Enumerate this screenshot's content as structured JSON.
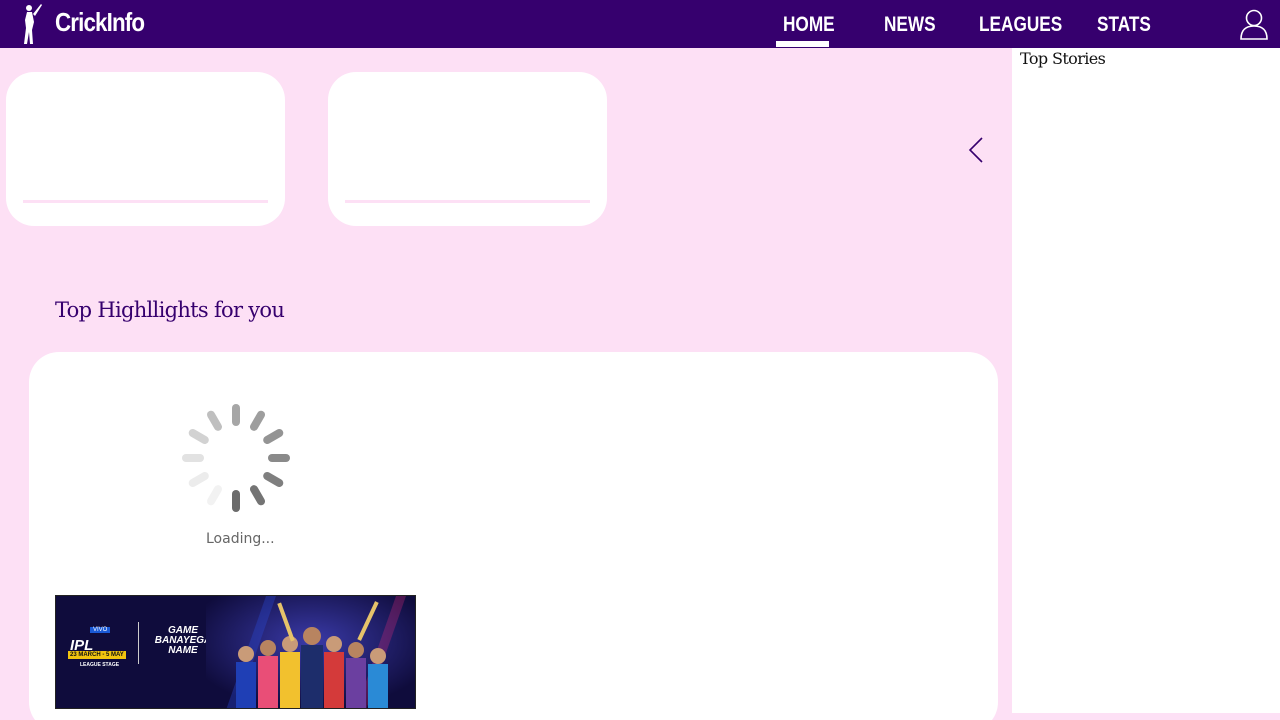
{
  "header": {
    "brand": "CrickInfo",
    "nav": [
      {
        "label": "HOME",
        "active": true
      },
      {
        "label": "NEWS",
        "active": false
      },
      {
        "label": "LEAGUES",
        "active": false
      },
      {
        "label": "STATS",
        "active": false
      }
    ],
    "user_icon": "user-icon",
    "logo_icon": "cricketer-logo-icon"
  },
  "colors": {
    "header_bg": "#36006e",
    "page_bg": "#fde0f5",
    "card_bg": "#ffffff",
    "heading": "#36006e"
  },
  "match_cards": [
    {
      "id": "card-1"
    },
    {
      "id": "card-2"
    }
  ],
  "carousel": {
    "prev_icon": "chevron-left-icon"
  },
  "highlights": {
    "title": "Top Highllights for you",
    "loading_text": "Loading..."
  },
  "banner": {
    "sponsor": "VIVO",
    "league": "IPL",
    "dates": "23 MARCH - 5 MAY",
    "stage": "LEAGUE STAGE",
    "tagline": "GAME BANAYEGA NAME"
  },
  "sidebar": {
    "title": "Top Stories"
  }
}
